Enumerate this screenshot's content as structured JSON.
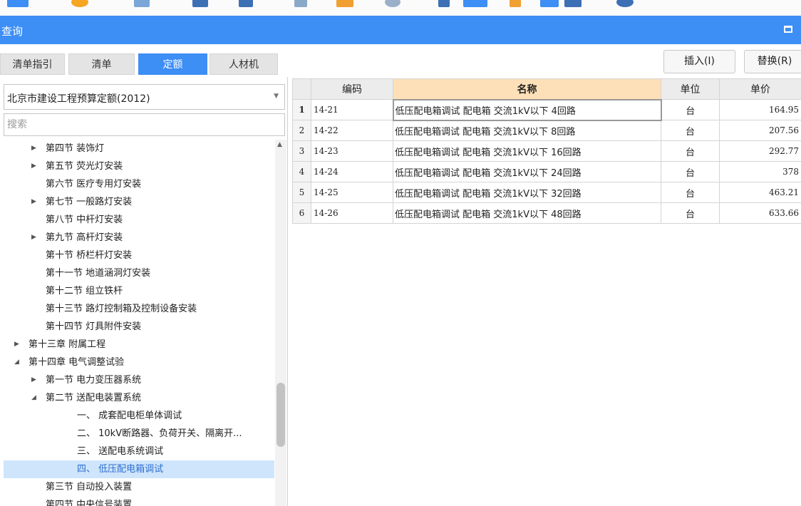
{
  "window": {
    "title": "查询"
  },
  "tabs": [
    {
      "label": "清单指引",
      "active": false
    },
    {
      "label": "清单",
      "active": false
    },
    {
      "label": "定额",
      "active": true
    },
    {
      "label": "人材机",
      "active": false
    }
  ],
  "actions": {
    "insert_label": "插入(I)",
    "replace_label": "替换(R)"
  },
  "quota_library": {
    "selected": "北京市建设工程预算定额(2012)"
  },
  "search": {
    "placeholder": "搜索",
    "value": ""
  },
  "tree": [
    {
      "label": "第四节 装饰灯",
      "level": 2,
      "expander": "collapsed"
    },
    {
      "label": "第五节 荧光灯安装",
      "level": 2,
      "expander": "collapsed"
    },
    {
      "label": "第六节 医疗专用灯安装",
      "level": 2,
      "expander": "none"
    },
    {
      "label": "第七节 一般路灯安装",
      "level": 2,
      "expander": "collapsed"
    },
    {
      "label": "第八节 中杆灯安装",
      "level": 2,
      "expander": "none"
    },
    {
      "label": "第九节 高杆灯安装",
      "level": 2,
      "expander": "collapsed"
    },
    {
      "label": "第十节 桥栏杆灯安装",
      "level": 2,
      "expander": "none"
    },
    {
      "label": "第十一节 地道涵洞灯安装",
      "level": 2,
      "expander": "none"
    },
    {
      "label": "第十二节 组立铁杆",
      "level": 2,
      "expander": "none"
    },
    {
      "label": "第十三节 路灯控制箱及控制设备安装",
      "level": 2,
      "expander": "none"
    },
    {
      "label": "第十四节 灯具附件安装",
      "level": 2,
      "expander": "none"
    },
    {
      "label": "第十三章 附属工程",
      "level": 1,
      "expander": "collapsed"
    },
    {
      "label": "第十四章 电气调整试验",
      "level": 1,
      "expander": "expanded"
    },
    {
      "label": "第一节 电力变压器系统",
      "level": 2,
      "expander": "collapsed"
    },
    {
      "label": "第二节 送配电装置系统",
      "level": 2,
      "expander": "expanded"
    },
    {
      "label": "一、 成套配电柜单体调试",
      "level": 3,
      "expander": "none"
    },
    {
      "label": "二、 10kV断路器、负荷开关、隔离开...",
      "level": 3,
      "expander": "none"
    },
    {
      "label": "三、 送配电系统调试",
      "level": 3,
      "expander": "none"
    },
    {
      "label": "四、 低压配电箱调试",
      "level": 3,
      "expander": "none",
      "selected": true
    },
    {
      "label": "第三节 自动投入装置",
      "level": 2,
      "expander": "none"
    },
    {
      "label": "第四节 中央信号装置",
      "level": 2,
      "expander": "none"
    }
  ],
  "grid": {
    "columns": [
      "编码",
      "名称",
      "单位",
      "单价"
    ],
    "sorted_column": "名称",
    "current_row": 1,
    "rows": [
      {
        "no": "1",
        "code": "14-21",
        "name": "低压配电箱调试 配电箱 交流1kV以下 4回路",
        "unit": "台",
        "price": "164.95"
      },
      {
        "no": "2",
        "code": "14-22",
        "name": "低压配电箱调试 配电箱 交流1kV以下 8回路",
        "unit": "台",
        "price": "207.56"
      },
      {
        "no": "3",
        "code": "14-23",
        "name": "低压配电箱调试 配电箱 交流1kV以下 16回路",
        "unit": "台",
        "price": "292.77"
      },
      {
        "no": "4",
        "code": "14-24",
        "name": "低压配电箱调试 配电箱 交流1kV以下 24回路",
        "unit": "台",
        "price": "378"
      },
      {
        "no": "5",
        "code": "14-25",
        "name": "低压配电箱调试 配电箱 交流1kV以下 32回路",
        "unit": "台",
        "price": "463.21"
      },
      {
        "no": "6",
        "code": "14-26",
        "name": "低压配电箱调试 配电箱 交流1kV以下 48回路",
        "unit": "台",
        "price": "633.66"
      }
    ]
  },
  "colors": {
    "accent": "#3d8ef5",
    "selected_row_bg": "#cfe5fb",
    "sorted_header_bg": "#fde0b8"
  }
}
